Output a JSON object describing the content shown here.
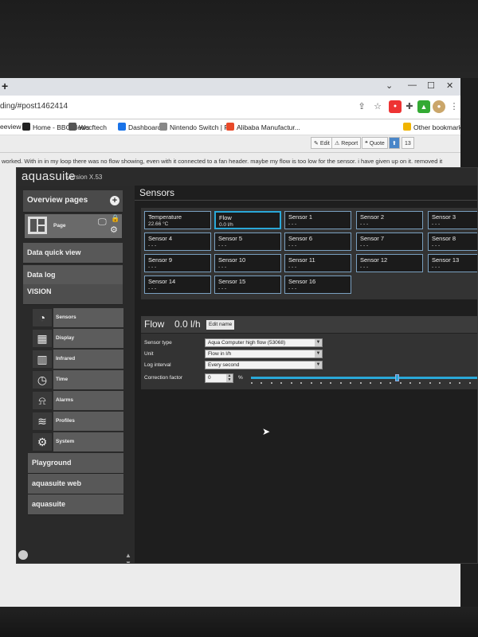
{
  "browser": {
    "new_tab": "+",
    "window_controls": [
      "⌄",
      "—",
      "☐",
      "✕"
    ],
    "url": "ding/#post1462414",
    "bookmarks": [
      {
        "label": "eeview",
        "color": "#ffffff"
      },
      {
        "label": "Home - BBC News",
        "color": "#222222"
      },
      {
        "label": "Wccftech",
        "color": "#555555"
      },
      {
        "label": "Dashboard",
        "color": "#1a73e8"
      },
      {
        "label": "Nintendo Switch | P...",
        "color": "#888888"
      },
      {
        "label": "Alibaba Manufactur...",
        "color": "#e84a2a"
      },
      {
        "label": "Other bookmarks",
        "color": "#f0b400"
      }
    ],
    "forum": {
      "edit": "Edit",
      "report": "Report",
      "quote": "Quote",
      "likes": "13",
      "post_text": "worked. With in in my loop there was no flow showing, even with it connected to a fan header. maybe my flow is too low for the sensor. i have given up on it. removed it"
    }
  },
  "app": {
    "name": "aquasuite",
    "version": "Version X.53",
    "vertical_brand": "aquacomputer",
    "watermark": "aqu"
  },
  "sidebar": {
    "overview_pages": "Overview pages",
    "page_label": "Page",
    "data_quick_view": "Data quick view",
    "data_log": "Data log",
    "vision": "VISION",
    "vision_items": [
      {
        "label": "Sensors",
        "icon": "gauge-icon"
      },
      {
        "label": "Display",
        "icon": "display-icon"
      },
      {
        "label": "Infrared",
        "icon": "remote-icon"
      },
      {
        "label": "Time",
        "icon": "clock-icon"
      },
      {
        "label": "Alarms",
        "icon": "alarm-icon"
      },
      {
        "label": "Profiles",
        "icon": "layers-icon"
      },
      {
        "label": "System",
        "icon": "gear-icon"
      }
    ],
    "playground": "Playground",
    "aquasuite_web": "aquasuite web",
    "aquasuite": "aquasuite"
  },
  "main": {
    "title": "Sensors",
    "sensors": [
      {
        "name": "Temperature",
        "value": "22.66 °C"
      },
      {
        "name": "Flow",
        "value": "0.0 l/h"
      },
      {
        "name": "Sensor 1",
        "value": "- - -"
      },
      {
        "name": "Sensor 2",
        "value": "- - -"
      },
      {
        "name": "Sensor 3",
        "value": "- - -"
      },
      {
        "name": "Sensor 4",
        "value": "- - -"
      },
      {
        "name": "Sensor 5",
        "value": "- - -"
      },
      {
        "name": "Sensor 6",
        "value": "- - -"
      },
      {
        "name": "Sensor 7",
        "value": "- - -"
      },
      {
        "name": "Sensor 8",
        "value": "- - -"
      },
      {
        "name": "Sensor 9",
        "value": "- - -"
      },
      {
        "name": "Sensor 10",
        "value": "- - -"
      },
      {
        "name": "Sensor 11",
        "value": "- - -"
      },
      {
        "name": "Sensor 12",
        "value": "- - -"
      },
      {
        "name": "Sensor 13",
        "value": "- - -"
      },
      {
        "name": "Sensor 14",
        "value": "- - -"
      },
      {
        "name": "Sensor 15",
        "value": "- - -"
      },
      {
        "name": "Sensor 16",
        "value": "- - -"
      }
    ],
    "selected_sensor": "Flow",
    "detail": {
      "name": "Flow",
      "value": "0.0 l/h",
      "edit_button": "Edit name",
      "sensor_type_label": "Sensor type",
      "sensor_type": "Aqua Computer high flow (53068)",
      "unit_label": "Unit",
      "unit": "Flow in l/h",
      "log_interval_label": "Log interval",
      "log_interval": "Every second",
      "correction_label": "Correction factor",
      "correction_value": "0",
      "correction_unit": "%",
      "correction_slider_fraction": 0.64
    },
    "accent_color": "#2aa8d8"
  }
}
